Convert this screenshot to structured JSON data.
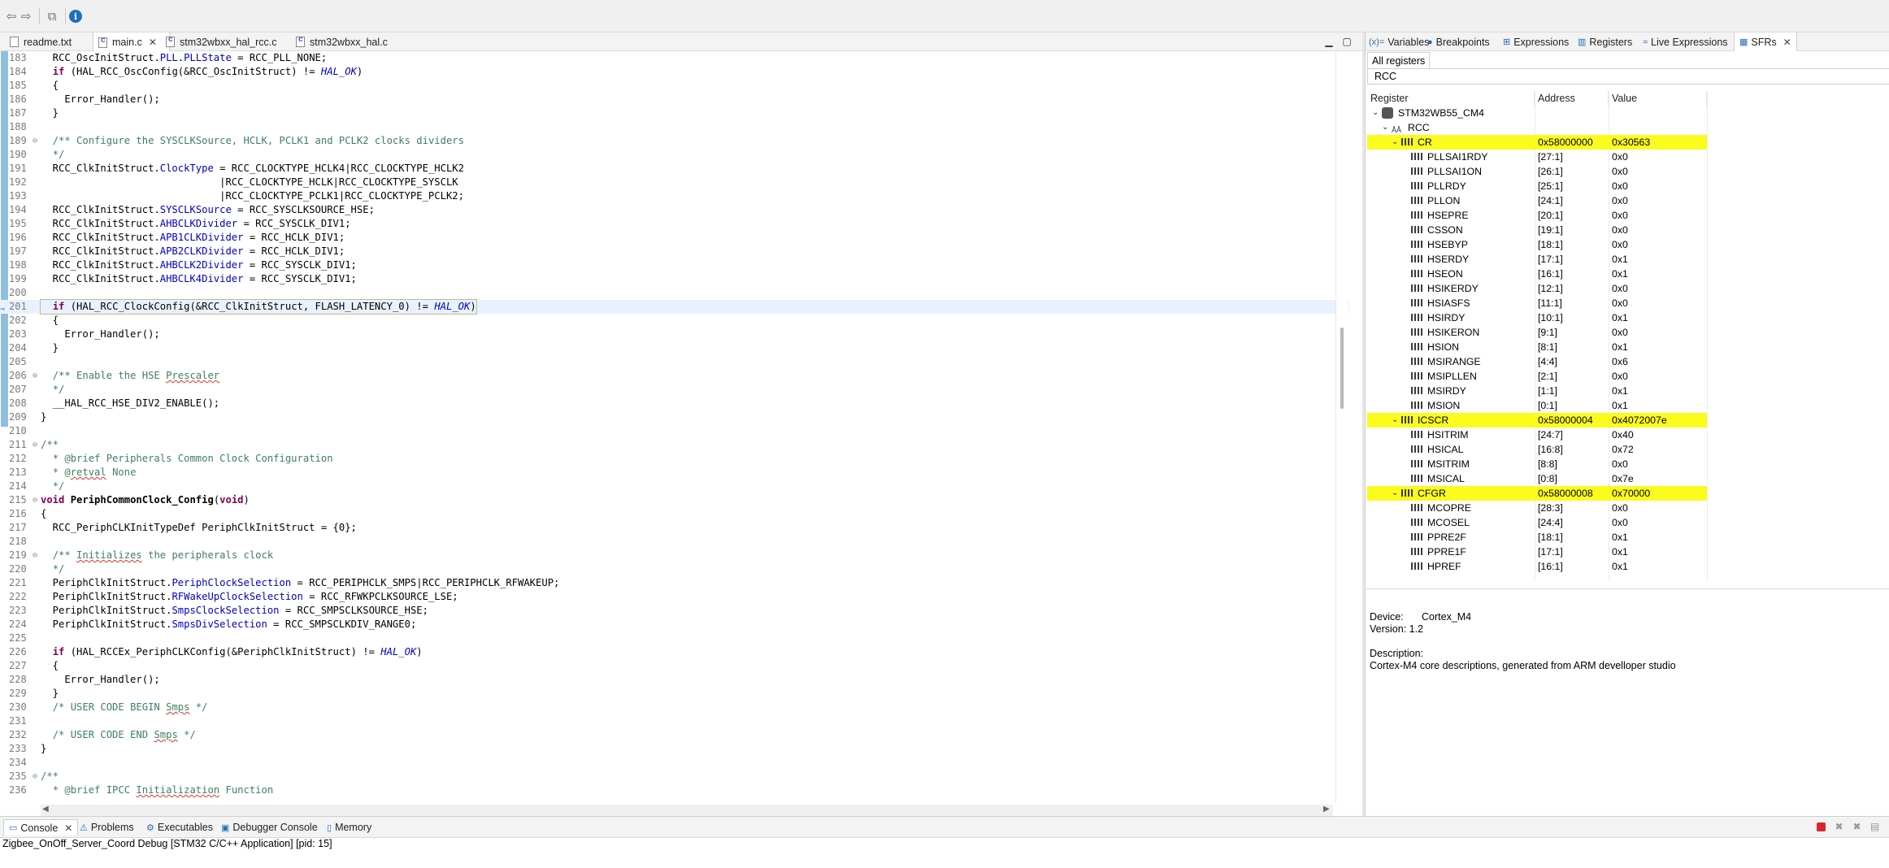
{
  "toolbar": {
    "icons": [
      "back-arrow-icon",
      "forward-arrow-icon",
      "open-external-icon",
      "info-icon"
    ],
    "info_glyph": "i"
  },
  "editor": {
    "tabs": [
      {
        "label": "readme.txt",
        "active": false
      },
      {
        "label": "main.c",
        "active": true
      },
      {
        "label": "stm32wbxx_hal_rcc.c",
        "active": false
      },
      {
        "label": "stm32wbxx_hal.c",
        "active": false
      }
    ],
    "highlighted_line": 201,
    "lines": [
      {
        "n": "183",
        "html": "  RCC_OscInitStruct.<span class=\"fld\">PLL</span>.<span class=\"fld\">PLLState</span> = RCC_PLL_NONE;"
      },
      {
        "n": "184",
        "html": "  <span class=\"kw\">if</span> (HAL_RCC_OscConfig(&amp;RCC_OscInitStruct) != <span class=\"mac\">HAL_OK</span>)"
      },
      {
        "n": "185",
        "html": "  {"
      },
      {
        "n": "186",
        "html": "    Error_Handler();"
      },
      {
        "n": "187",
        "html": "  }"
      },
      {
        "n": "188",
        "html": ""
      },
      {
        "n": "189",
        "fold": true,
        "html": "  <span class=\"cm\">/** Configure the SYSCLKSource, HCLK, PCLK1 and PCLK2 clocks dividers</span>"
      },
      {
        "n": "190",
        "html": "  <span class=\"cm\">*/</span>"
      },
      {
        "n": "191",
        "html": "  RCC_ClkInitStruct.<span class=\"fld\">ClockType</span> = RCC_CLOCKTYPE_HCLK4|RCC_CLOCKTYPE_HCLK2"
      },
      {
        "n": "192",
        "html": "                              |RCC_CLOCKTYPE_HCLK|RCC_CLOCKTYPE_SYSCLK"
      },
      {
        "n": "193",
        "html": "                              |RCC_CLOCKTYPE_PCLK1|RCC_CLOCKTYPE_PCLK2;"
      },
      {
        "n": "194",
        "html": "  RCC_ClkInitStruct.<span class=\"fld\">SYSCLKSource</span> = RCC_SYSCLKSOURCE_HSE;"
      },
      {
        "n": "195",
        "html": "  RCC_ClkInitStruct.<span class=\"fld\">AHBCLKDivider</span> = RCC_SYSCLK_DIV1;"
      },
      {
        "n": "196",
        "html": "  RCC_ClkInitStruct.<span class=\"fld\">APB1CLKDivider</span> = RCC_HCLK_DIV1;"
      },
      {
        "n": "197",
        "html": "  RCC_ClkInitStruct.<span class=\"fld\">APB2CLKDivider</span> = RCC_HCLK_DIV1;"
      },
      {
        "n": "198",
        "html": "  RCC_ClkInitStruct.<span class=\"fld\">AHBCLK2Divider</span> = RCC_SYSCLK_DIV1;"
      },
      {
        "n": "199",
        "html": "  RCC_ClkInitStruct.<span class=\"fld\">AHBCLK4Divider</span> = RCC_SYSCLK_DIV1;"
      },
      {
        "n": "200",
        "html": ""
      },
      {
        "n": "201",
        "html": "  <span class=\"kw\">if</span> (HAL_RCC_ClockConfig(&amp;RCC_ClkInitStruct, FLASH_LATENCY_0) != <span class=\"mac\">HAL_OK</span>)"
      },
      {
        "n": "202",
        "html": "  {"
      },
      {
        "n": "203",
        "html": "    Error_Handler();"
      },
      {
        "n": "204",
        "html": "  }"
      },
      {
        "n": "205",
        "html": ""
      },
      {
        "n": "206",
        "fold": true,
        "html": "  <span class=\"cm\">/** Enable the HSE <span class=\"sq\">Prescaler</span></span>"
      },
      {
        "n": "207",
        "html": "  <span class=\"cm\">*/</span>"
      },
      {
        "n": "208",
        "html": "  __HAL_RCC_HSE_DIV2_ENABLE();"
      },
      {
        "n": "209",
        "html": "}"
      },
      {
        "n": "210",
        "html": ""
      },
      {
        "n": "211",
        "fold": true,
        "html": "<span class=\"cm\">/**</span>"
      },
      {
        "n": "212",
        "html": "  <span class=\"cm\">* @brief Peripherals Common Clock Configuration</span>"
      },
      {
        "n": "213",
        "html": "  <span class=\"cm\">* @<span class=\"sq\">retval</span> None</span>"
      },
      {
        "n": "214",
        "html": "  <span class=\"cm\">*/</span>"
      },
      {
        "n": "215",
        "fold": true,
        "html": "<span class=\"kw\">void</span> <span class=\"fn\">PeriphCommonClock_Config</span>(<span class=\"kw\">void</span>)"
      },
      {
        "n": "216",
        "html": "{"
      },
      {
        "n": "217",
        "html": "  RCC_PeriphCLKInitTypeDef PeriphClkInitStruct = {0};"
      },
      {
        "n": "218",
        "html": ""
      },
      {
        "n": "219",
        "fold": true,
        "html": "  <span class=\"cm\">/** <span class=\"sq\">Initializes</span> the peripherals clock</span>"
      },
      {
        "n": "220",
        "html": "  <span class=\"cm\">*/</span>"
      },
      {
        "n": "221",
        "html": "  PeriphClkInitStruct.<span class=\"fld\">PeriphClockSelection</span> = RCC_PERIPHCLK_SMPS|RCC_PERIPHCLK_RFWAKEUP;"
      },
      {
        "n": "222",
        "html": "  PeriphClkInitStruct.<span class=\"fld\">RFWakeUpClockSelection</span> = RCC_RFWKPCLKSOURCE_LSE;"
      },
      {
        "n": "223",
        "html": "  PeriphClkInitStruct.<span class=\"fld\">SmpsClockSelection</span> = RCC_SMPSCLKSOURCE_HSE;"
      },
      {
        "n": "224",
        "html": "  PeriphClkInitStruct.<span class=\"fld\">SmpsDivSelection</span> = RCC_SMPSCLKDIV_RANGE0;"
      },
      {
        "n": "225",
        "html": ""
      },
      {
        "n": "226",
        "html": "  <span class=\"kw\">if</span> (HAL_RCCEx_PeriphCLKConfig(&amp;PeriphClkInitStruct) != <span class=\"mac\">HAL_OK</span>)"
      },
      {
        "n": "227",
        "html": "  {"
      },
      {
        "n": "228",
        "html": "    Error_Handler();"
      },
      {
        "n": "229",
        "html": "  }"
      },
      {
        "n": "230",
        "html": "  <span class=\"cm\">/* USER CODE BEGIN <span class=\"sq\">Smps</span> */</span>"
      },
      {
        "n": "231",
        "html": ""
      },
      {
        "n": "232",
        "html": "  <span class=\"cm\">/* USER CODE END <span class=\"sq\">Smps</span> */</span>"
      },
      {
        "n": "233",
        "html": "}"
      },
      {
        "n": "234",
        "html": ""
      },
      {
        "n": "235",
        "fold": true,
        "html": "<span class=\"cm\">/**</span>"
      },
      {
        "n": "236",
        "html": "  <span class=\"cm\">* @brief IPCC <span class=\"sq\">Initialization</span> Function</span>"
      }
    ]
  },
  "right_panel": {
    "tabs": [
      {
        "label": "Variables",
        "icon": "(x)="
      },
      {
        "label": "Breakpoints",
        "icon": "●"
      },
      {
        "label": "Expressions",
        "icon": "⊞"
      },
      {
        "label": "Registers",
        "icon": "▥"
      },
      {
        "label": "Live Expressions",
        "icon": "≈"
      },
      {
        "label": "SFRs",
        "icon": "▦",
        "active": true
      }
    ],
    "subtab": "All registers",
    "filter_value": "RCC",
    "columns": [
      "Register",
      "Address",
      "Value"
    ],
    "rows": [
      {
        "level": 0,
        "type": "chip",
        "open": true,
        "name": "STM32WB55_CM4",
        "addr": "",
        "val": "",
        "yel": false
      },
      {
        "level": 1,
        "type": "per",
        "open": true,
        "name": "RCC",
        "addr": "",
        "val": "",
        "yel": false
      },
      {
        "level": 2,
        "type": "reg",
        "open": true,
        "name": "CR",
        "addr": "0x58000000",
        "val": "0x30563",
        "yel": true
      },
      {
        "level": 3,
        "type": "bits",
        "name": "PLLSAI1RDY",
        "addr": "[27:1]",
        "val": "0x0"
      },
      {
        "level": 3,
        "type": "bits",
        "name": "PLLSAI1ON",
        "addr": "[26:1]",
        "val": "0x0"
      },
      {
        "level": 3,
        "type": "bits",
        "name": "PLLRDY",
        "addr": "[25:1]",
        "val": "0x0"
      },
      {
        "level": 3,
        "type": "bits",
        "name": "PLLON",
        "addr": "[24:1]",
        "val": "0x0"
      },
      {
        "level": 3,
        "type": "bits",
        "name": "HSEPRE",
        "addr": "[20:1]",
        "val": "0x0"
      },
      {
        "level": 3,
        "type": "bits",
        "name": "CSSON",
        "addr": "[19:1]",
        "val": "0x0"
      },
      {
        "level": 3,
        "type": "bits",
        "name": "HSEBYP",
        "addr": "[18:1]",
        "val": "0x0"
      },
      {
        "level": 3,
        "type": "bits",
        "name": "HSERDY",
        "addr": "[17:1]",
        "val": "0x1"
      },
      {
        "level": 3,
        "type": "bits",
        "name": "HSEON",
        "addr": "[16:1]",
        "val": "0x1"
      },
      {
        "level": 3,
        "type": "bits",
        "name": "HSIKERDY",
        "addr": "[12:1]",
        "val": "0x0"
      },
      {
        "level": 3,
        "type": "bits",
        "name": "HSIASFS",
        "addr": "[11:1]",
        "val": "0x0"
      },
      {
        "level": 3,
        "type": "bits",
        "name": "HSIRDY",
        "addr": "[10:1]",
        "val": "0x1"
      },
      {
        "level": 3,
        "type": "bits",
        "name": "HSIKERON",
        "addr": "[9:1]",
        "val": "0x0"
      },
      {
        "level": 3,
        "type": "bits",
        "name": "HSION",
        "addr": "[8:1]",
        "val": "0x1"
      },
      {
        "level": 3,
        "type": "bits",
        "name": "MSIRANGE",
        "addr": "[4:4]",
        "val": "0x6"
      },
      {
        "level": 3,
        "type": "bits",
        "name": "MSIPLLEN",
        "addr": "[2:1]",
        "val": "0x0"
      },
      {
        "level": 3,
        "type": "bits",
        "name": "MSIRDY",
        "addr": "[1:1]",
        "val": "0x1"
      },
      {
        "level": 3,
        "type": "bits",
        "name": "MSION",
        "addr": "[0:1]",
        "val": "0x1"
      },
      {
        "level": 2,
        "type": "reg",
        "open": true,
        "name": "ICSCR",
        "addr": "0x58000004",
        "val": "0x4072007e",
        "yel": true
      },
      {
        "level": 3,
        "type": "bits",
        "name": "HSITRIM",
        "addr": "[24:7]",
        "val": "0x40"
      },
      {
        "level": 3,
        "type": "bits",
        "name": "HSICAL",
        "addr": "[16:8]",
        "val": "0x72"
      },
      {
        "level": 3,
        "type": "bits",
        "name": "MSITRIM",
        "addr": "[8:8]",
        "val": "0x0"
      },
      {
        "level": 3,
        "type": "bits",
        "name": "MSICAL",
        "addr": "[0:8]",
        "val": "0x7e"
      },
      {
        "level": 2,
        "type": "reg",
        "open": true,
        "name": "CFGR",
        "addr": "0x58000008",
        "val": "0x70000",
        "yel": true
      },
      {
        "level": 3,
        "type": "bits",
        "name": "MCOPRE",
        "addr": "[28:3]",
        "val": "0x0"
      },
      {
        "level": 3,
        "type": "bits",
        "name": "MCOSEL",
        "addr": "[24:4]",
        "val": "0x0"
      },
      {
        "level": 3,
        "type": "bits",
        "name": "PPRE2F",
        "addr": "[18:1]",
        "val": "0x1"
      },
      {
        "level": 3,
        "type": "bits",
        "name": "PPRE1F",
        "addr": "[17:1]",
        "val": "0x1"
      },
      {
        "level": 3,
        "type": "bits",
        "name": "HPREF",
        "addr": "[16:1]",
        "val": "0x1"
      }
    ],
    "device_label": "Device:",
    "device_value": "Cortex_M4",
    "version_text": "Version: 1.2",
    "description_label": "Description:",
    "description_text": "Cortex-M4 core descriptions, generated from ARM develloper studio"
  },
  "bottom": {
    "tabs": [
      {
        "label": "Console",
        "icon": "▭",
        "active": true
      },
      {
        "label": "Problems",
        "icon": "⚠"
      },
      {
        "label": "Executables",
        "icon": "⚙"
      },
      {
        "label": "Debugger Console",
        "icon": "▣"
      },
      {
        "label": "Memory",
        "icon": "▯"
      }
    ],
    "console_text": "Zigbee_OnOff_Server_Coord Debug [STM32 C/C++ Application]  [pid: 15]"
  },
  "colors": {
    "highlight_row": "#fbfb1e",
    "current_line": "#e8f2fe",
    "keyword": "#7f0055",
    "comment": "#3f7f5f",
    "field": "#0000c0"
  }
}
